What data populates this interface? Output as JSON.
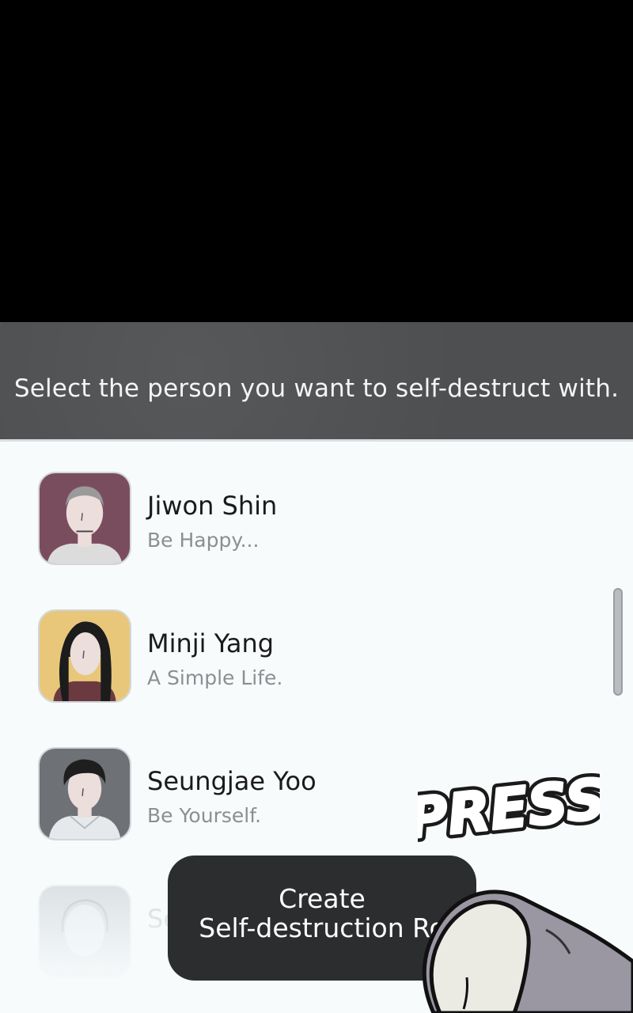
{
  "header": {
    "prompt": "Select the person you want to self-destruct with."
  },
  "contacts": [
    {
      "name": "Jiwon Shin",
      "status": "Be Happy...",
      "avatar_bg": "#7a4d5e"
    },
    {
      "name": "Minji Yang",
      "status": "A Simple Life.",
      "avatar_bg": "#e8c77a"
    },
    {
      "name": "Seungjae Yoo",
      "status": "Be Yourself.",
      "avatar_bg": "#6e7175"
    },
    {
      "name": "Se",
      "status": "",
      "avatar_bg": "#bfc6cc"
    }
  ],
  "sfx": {
    "press": "PRESS"
  },
  "action_button": {
    "line1": "Create",
    "line2": "Self-destruction Ro"
  },
  "colors": {
    "header_bg": "#4d4f51",
    "list_bg": "#f7fbfc",
    "button_bg": "#2b2d2f"
  }
}
